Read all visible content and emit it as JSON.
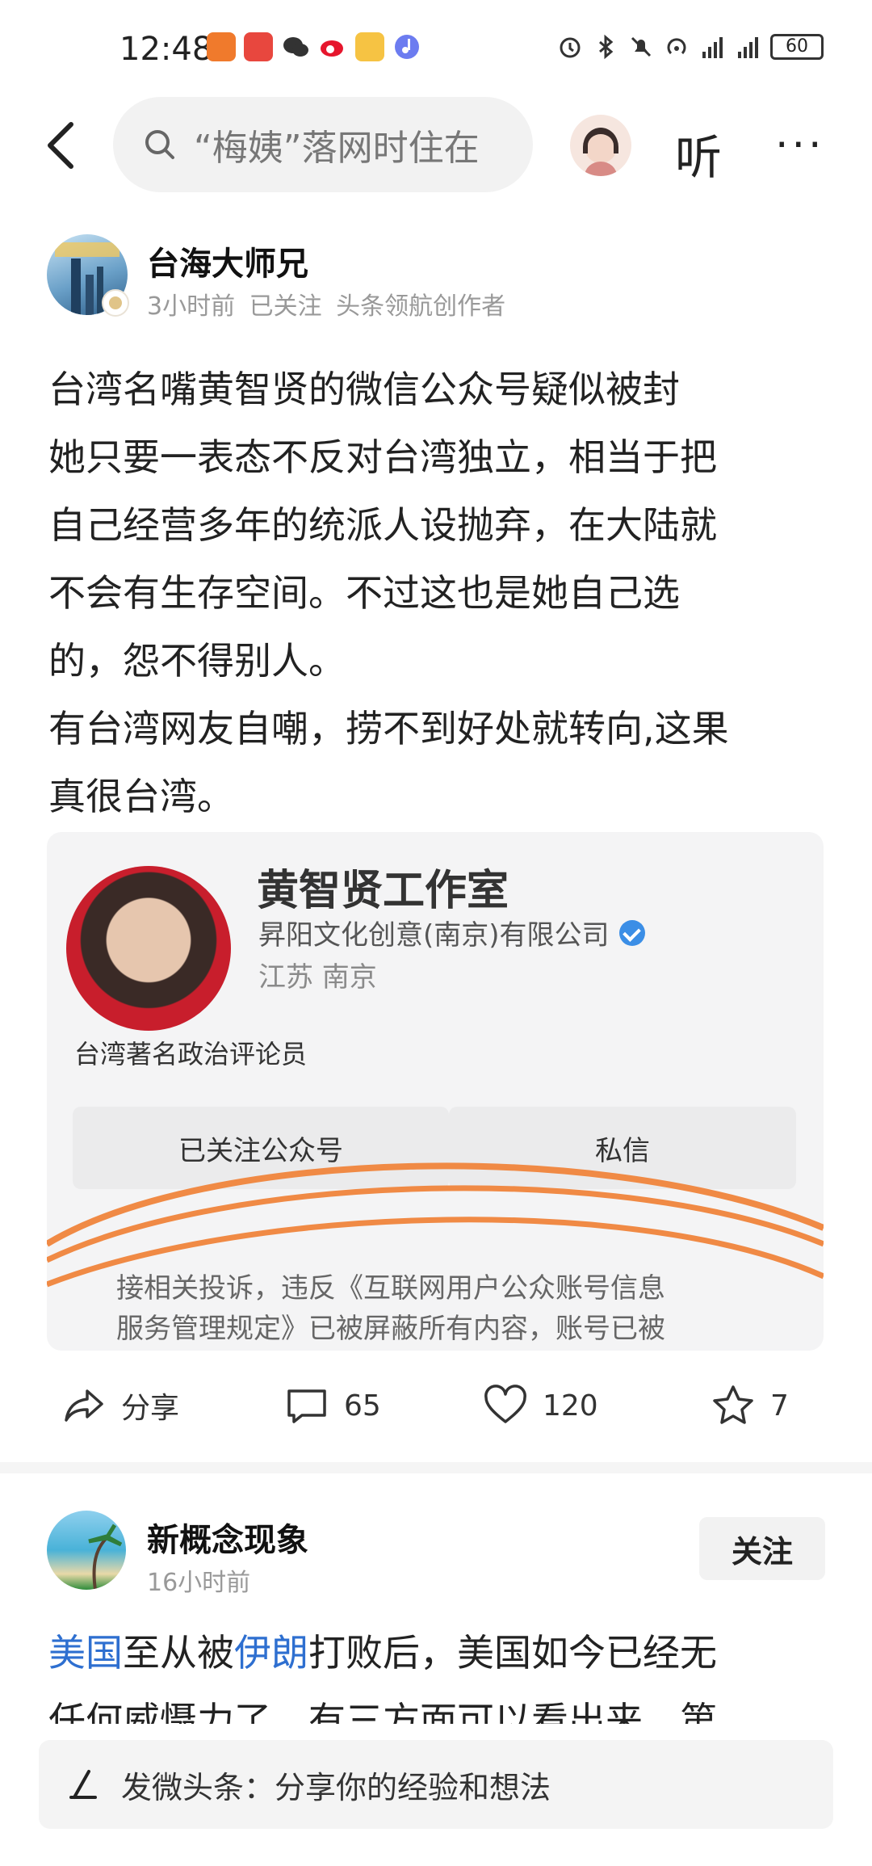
{
  "status_bar": {
    "time": "12:48",
    "battery": "60"
  },
  "nav": {
    "search_placeholder": "“梅姨”落网时住在",
    "listen_label": "听",
    "more_label": "···"
  },
  "post1": {
    "author": "台海大师兄",
    "meta": "3小时前  已关注  头条领航创作者",
    "body_lines": [
      "台湾名嘴黄智贤的微信公众号疑似被封",
      "她只要一表态不反对台湾独立，相当于把",
      "自己经营多年的统派人设抛弃，在大陆就",
      "不会有生存空间。不过这也是她自己选",
      "的，怨不得别人。",
      "有台湾网友自嘲，捞不到好处就转向,这果",
      "真很台湾。"
    ],
    "embed": {
      "title": "黄智贤工作室",
      "company": "昇阳文化创意(南京)有限公司",
      "location": "江苏 南京",
      "description": "台湾著名政治评论员",
      "button_following": "已关注公众号",
      "button_message": "私信",
      "notice_line1": "接相关投诉，违反《互联网用户公众账号信息",
      "notice_line2": "服务管理规定》已被屏蔽所有内容，账号已被"
    },
    "actions": {
      "share": "分享",
      "comments": "65",
      "likes": "120",
      "favorites": "7"
    }
  },
  "post2": {
    "author": "新概念现象",
    "time": "16小时前",
    "follow_label": "关注",
    "line1_link1": "美国",
    "line1_text1": "至从被",
    "line1_link2": "伊朗",
    "line1_text2": "打败后，美国如今已经无",
    "line2": "任何威慑力了，有三方面可以看出来，第"
  },
  "compose": {
    "label": "发微头条：分享你的经验和想法"
  }
}
